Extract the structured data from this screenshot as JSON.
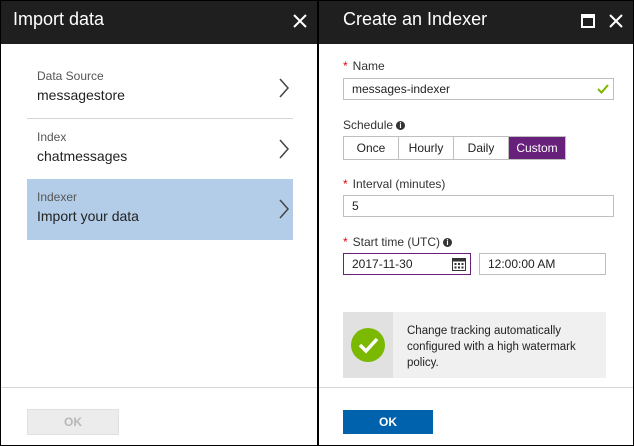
{
  "left_panel": {
    "title": "Import data",
    "close_icon": "close-icon",
    "items": [
      {
        "label": "Data Source",
        "value": "messagestore"
      },
      {
        "label": "Index",
        "value": "chatmessages"
      },
      {
        "label": "Indexer",
        "value": "Import your data",
        "selected": true
      }
    ],
    "ok_label": "OK"
  },
  "right_panel": {
    "title": "Create an Indexer",
    "maximize_icon": "maximize-icon",
    "close_icon": "close-icon",
    "name": {
      "label": "Name",
      "value": "messages-indexer",
      "required": true
    },
    "schedule": {
      "label": "Schedule",
      "options": [
        "Once",
        "Hourly",
        "Daily",
        "Custom"
      ],
      "selected": "Custom"
    },
    "interval": {
      "label": "Interval (minutes)",
      "value": "5",
      "required": true
    },
    "start_time": {
      "label": "Start time (UTC)",
      "date": "2017-11-30",
      "time": "12:00:00 AM",
      "required": true
    },
    "info_message": "Change tracking automatically configured with a high watermark policy.",
    "ok_label": "OK"
  },
  "colors": {
    "accent_purple": "#68217a",
    "primary_blue": "#0062ad",
    "selected_bg": "#b3cde8",
    "success_green": "#7bb800",
    "title_bar": "#1f1f1f"
  }
}
